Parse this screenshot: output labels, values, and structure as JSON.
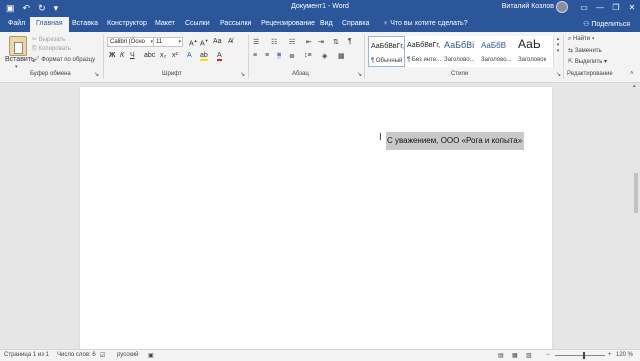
{
  "titlebar": {
    "doc_title": "Документ1 - Word",
    "user_name": "Виталий Козлов"
  },
  "tabs": [
    "Файл",
    "Главная",
    "Вставка",
    "Конструктор",
    "Макет",
    "Ссылки",
    "Рассылки",
    "Рецензирование",
    "Вид",
    "Справка"
  ],
  "tell_me": "Что вы хотите сделать?",
  "share": "Поделиться",
  "clipboard": {
    "paste": "Вставить",
    "cut": "Вырезать",
    "copy": "Копировать",
    "format_painter": "Формат по образцу",
    "group": "Буфер обмена"
  },
  "font": {
    "name": "Calibri (Осно",
    "size": "11",
    "group": "Шрифт",
    "bold": "Ж",
    "italic": "К",
    "underline": "Ч"
  },
  "paragraph": {
    "group": "Абзац"
  },
  "styles": {
    "group": "Стили",
    "items": [
      {
        "sample": "АаБбВвГг,",
        "name": "¶ Обычный"
      },
      {
        "sample": "АаБбВвГг,",
        "name": "¶ Без инте..."
      },
      {
        "sample": "АаБбВі",
        "name": "Заголово..."
      },
      {
        "sample": "АаБбВ",
        "name": "Заголово..."
      },
      {
        "sample": "АаЬ",
        "name": "Заголовок"
      }
    ]
  },
  "editing": {
    "find": "Найти",
    "replace": "Заменить",
    "select": "Выделить",
    "group": "Редактирование"
  },
  "document": {
    "selected_text": "С уважением, ООО «Рога и копыта»"
  },
  "status": {
    "page": "Страница 1 из 1",
    "words": "Число слов: 6",
    "language": "русский",
    "zoom": "120 %"
  }
}
